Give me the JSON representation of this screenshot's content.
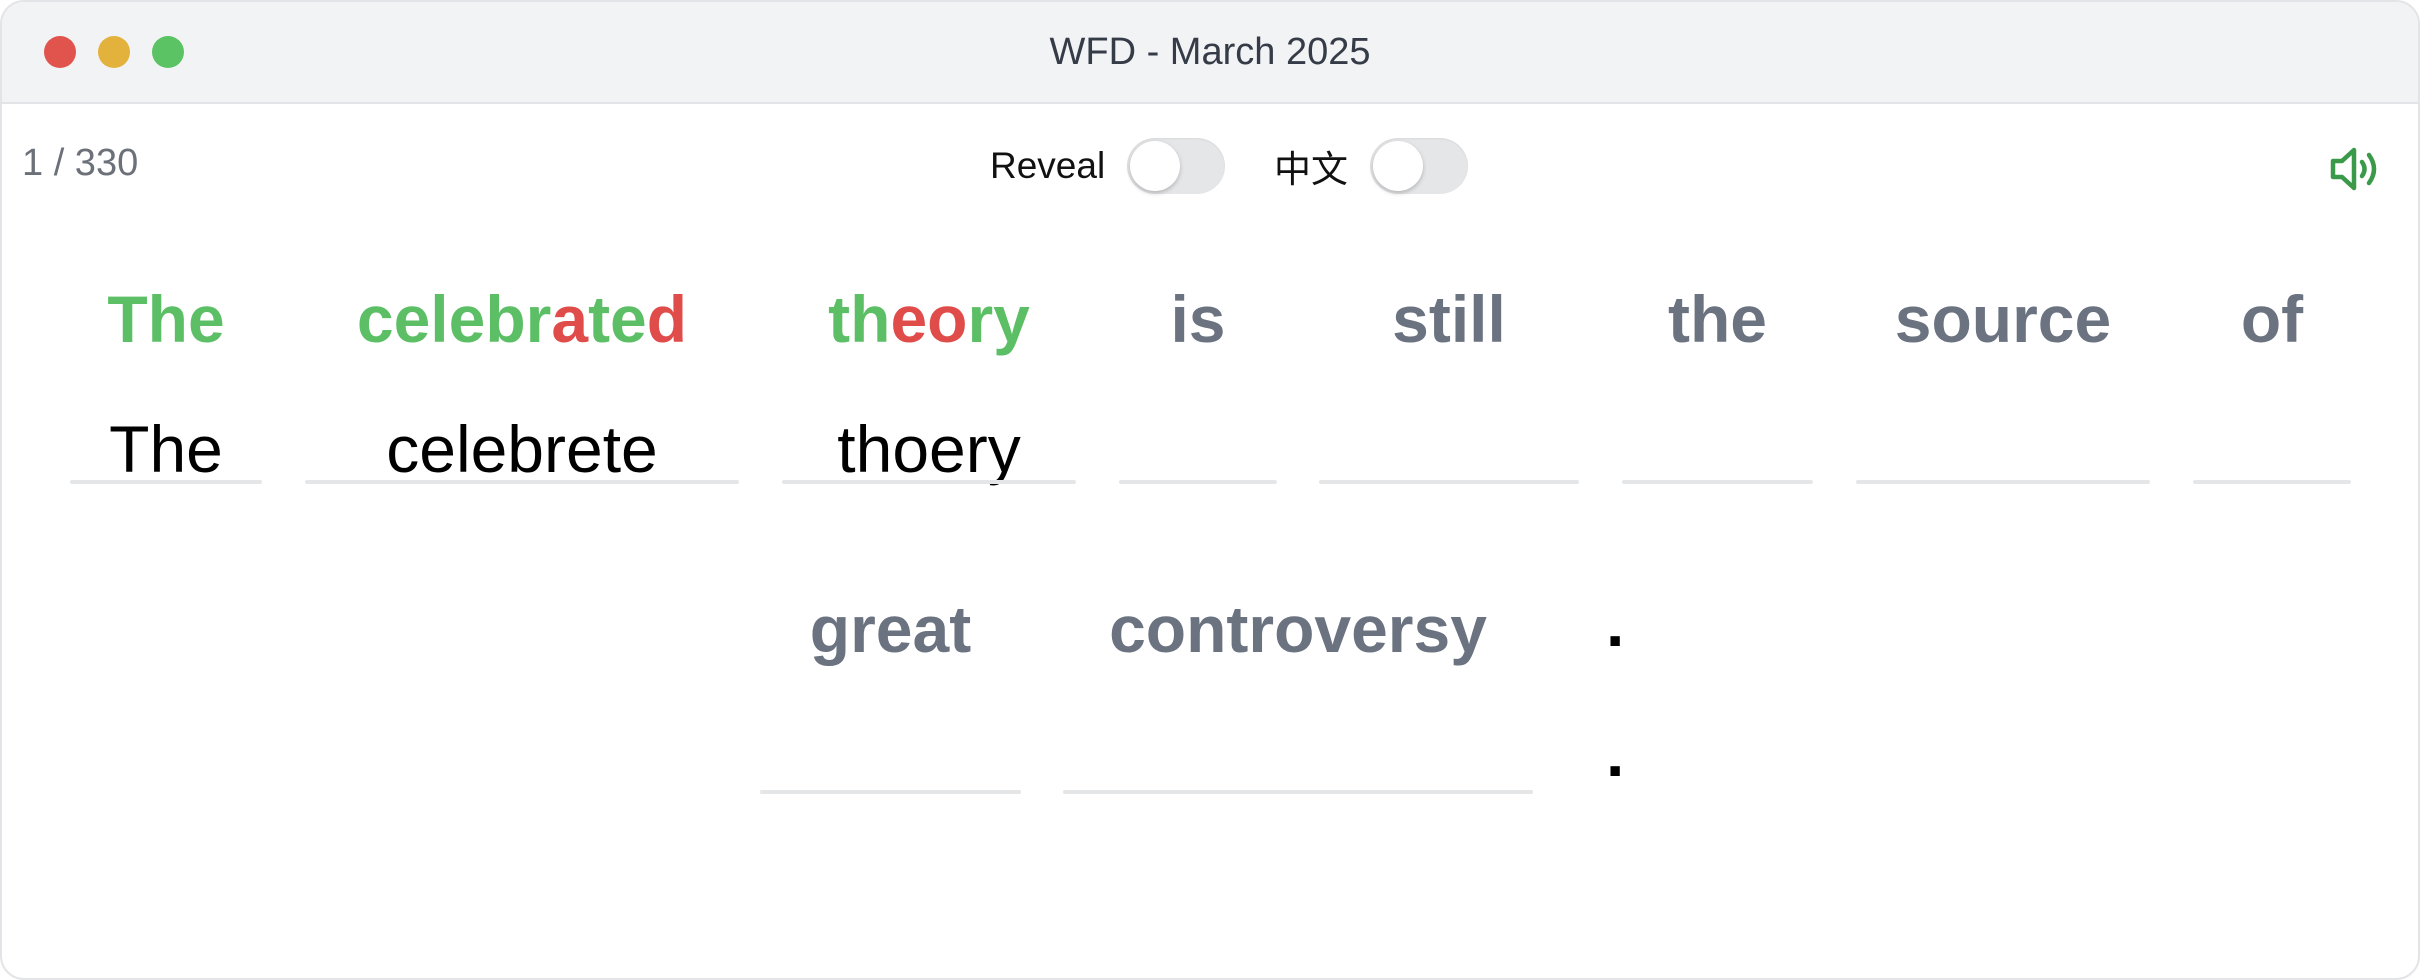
{
  "window": {
    "title": "WFD - March 2025"
  },
  "toolbar": {
    "counter": "1 / 330",
    "reveal_label": "Reveal",
    "reveal_on": false,
    "chinese_label": "中文",
    "chinese_on": false,
    "speaker_icon": "speaker-icon"
  },
  "colors": {
    "correct": "#5cbf66",
    "incorrect": "#e04c49",
    "pending": "#6b7280",
    "speaker": "#3a9a4a"
  },
  "sentence": {
    "words": [
      {
        "text": "The",
        "typed": "The",
        "segments": [
          {
            "t": "The",
            "s": "g"
          }
        ]
      },
      {
        "text": "celebrated",
        "typed": "celebrete",
        "segments": [
          {
            "t": "celebr",
            "s": "g"
          },
          {
            "t": "a",
            "s": "r"
          },
          {
            "t": "te",
            "s": "g"
          },
          {
            "t": "d",
            "s": "r"
          }
        ]
      },
      {
        "text": "theory",
        "typed": "thoery",
        "segments": [
          {
            "t": "th",
            "s": "g"
          },
          {
            "t": "eo",
            "s": "r"
          },
          {
            "t": "ry",
            "s": "g"
          }
        ]
      },
      {
        "text": "is",
        "typed": ""
      },
      {
        "text": "still",
        "typed": ""
      },
      {
        "text": "the",
        "typed": ""
      },
      {
        "text": "source",
        "typed": ""
      },
      {
        "text": "of",
        "typed": ""
      },
      {
        "text": "great",
        "typed": ""
      },
      {
        "text": "controversy",
        "typed": ""
      }
    ],
    "punct_target": ".",
    "punct_typed": "."
  }
}
